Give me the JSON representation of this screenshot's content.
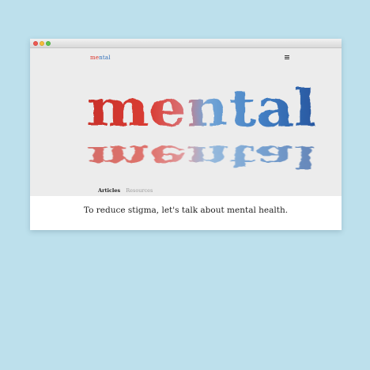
{
  "site": {
    "logo_part1": "me",
    "logo_part2": "ntal",
    "hero_word": "mental",
    "nav": [
      "Articles",
      "Resources"
    ],
    "tagline": "To reduce stigma, let's talk about mental health."
  },
  "colors": {
    "background": "#bde0ec",
    "red": "#d9342b",
    "blue": "#2f6fb8"
  },
  "icons": [
    "menu-icon"
  ]
}
